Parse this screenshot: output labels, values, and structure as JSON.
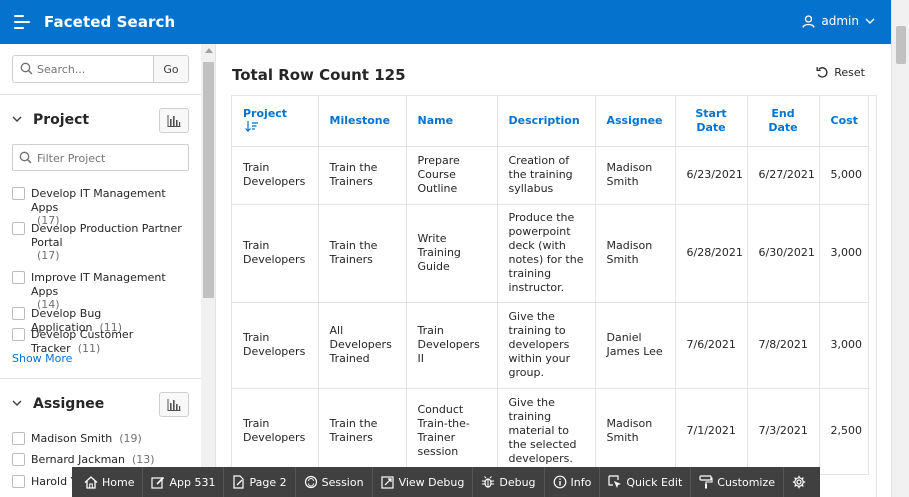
{
  "header": {
    "title": "Faceted Search",
    "user": "admin"
  },
  "search": {
    "placeholder": "Search...",
    "go_label": "Go"
  },
  "facets": [
    {
      "label": "Project",
      "filter_placeholder": "Filter Project",
      "options": [
        {
          "label": "Develop IT Management Apps",
          "count": "(17)"
        },
        {
          "label": "Develop Production Partner Portal",
          "count": "(17)"
        },
        {
          "label": "Improve IT Management Apps",
          "count": "(14)"
        },
        {
          "label": "Develop Bug Application",
          "count": "(11)"
        },
        {
          "label": "Develop Customer Tracker",
          "count": "(11)"
        }
      ],
      "show_more": "Show More"
    },
    {
      "label": "Assignee",
      "options": [
        {
          "label": "Madison Smith",
          "count": "(19)"
        },
        {
          "label": "Bernard Jackman",
          "count": "(13)"
        },
        {
          "label": "Harold Y",
          "count": ""
        }
      ]
    }
  ],
  "main": {
    "total": "Total Row Count 125",
    "reset_label": "Reset"
  },
  "table": {
    "columns": [
      "Project",
      "Milestone",
      "Name",
      "Description",
      "Assignee",
      "Start Date",
      "End Date",
      "Cost"
    ],
    "rows": [
      [
        "Train Developers",
        "Train the Trainers",
        "Prepare Course Outline",
        "Creation of the training syllabus",
        "Madison Smith",
        "6/23/2021",
        "6/27/2021",
        "5,000"
      ],
      [
        "Train Developers",
        "Train the Trainers",
        "Write Training Guide",
        "Produce the powerpoint deck (with notes) for the training instructor.",
        "Madison Smith",
        "6/28/2021",
        "6/30/2021",
        "3,000"
      ],
      [
        "Train Developers",
        "All Developers Trained",
        "Train Developers II",
        "Give the training to developers within your group.",
        "Daniel James Lee",
        "7/6/2021",
        "7/8/2021",
        "3,000"
      ],
      [
        "Train Developers",
        "Train the Trainers",
        "Conduct Train-the-Trainer session",
        "Give the training material to the selected developers.",
        "Madison Smith",
        "7/1/2021",
        "7/3/2021",
        "2,500"
      ]
    ]
  },
  "devbar": [
    "Home",
    "App 531",
    "Page 2",
    "Session",
    "View Debug",
    "Debug",
    "Info",
    "Quick Edit",
    "Customize"
  ],
  "colors": {
    "header": "#0572ce",
    "link": "#0572ce",
    "devbar": "#404040"
  }
}
